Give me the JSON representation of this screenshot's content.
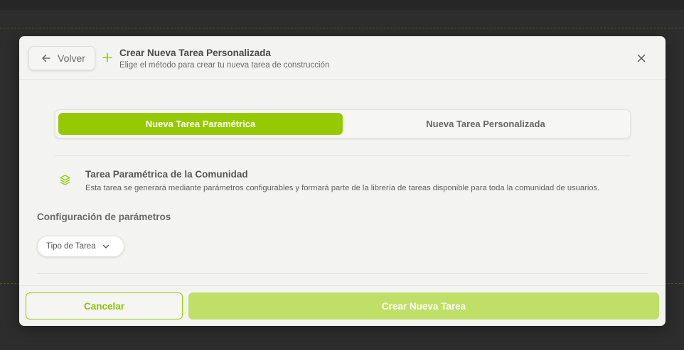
{
  "colors": {
    "accent": "#95c901",
    "accent_disabled": "#bfdf66",
    "modal_bg": "#f3f3f2",
    "backdrop": "#2d2d2d"
  },
  "header": {
    "back_label": "Volver",
    "back_icon": "arrow-left-icon",
    "add_icon": "plus-icon",
    "title": "Crear Nueva Tarea Personalizada",
    "subtitle": "Elige el método para crear tu nueva tarea de construcción",
    "close_icon": "close-icon"
  },
  "tabs": [
    {
      "label": "Nueva Tarea Paramétrica",
      "active": true
    },
    {
      "label": "Nueva Tarea Personalizada",
      "active": false
    }
  ],
  "info": {
    "icon": "layers-icon",
    "title": "Tarea Paramétrica de la Comunidad",
    "description": "Esta tarea se generará mediante parámetros configurables y formará parte de la librería de tareas disponible para toda la comunidad de usuarios."
  },
  "parameters": {
    "section_label": "Configuración de parámetros",
    "select_label": "Tipo de Tarea",
    "select_icon": "chevron-down-icon"
  },
  "footer": {
    "cancel_label": "Cancelar",
    "create_label": "Crear Nueva Tarea"
  }
}
